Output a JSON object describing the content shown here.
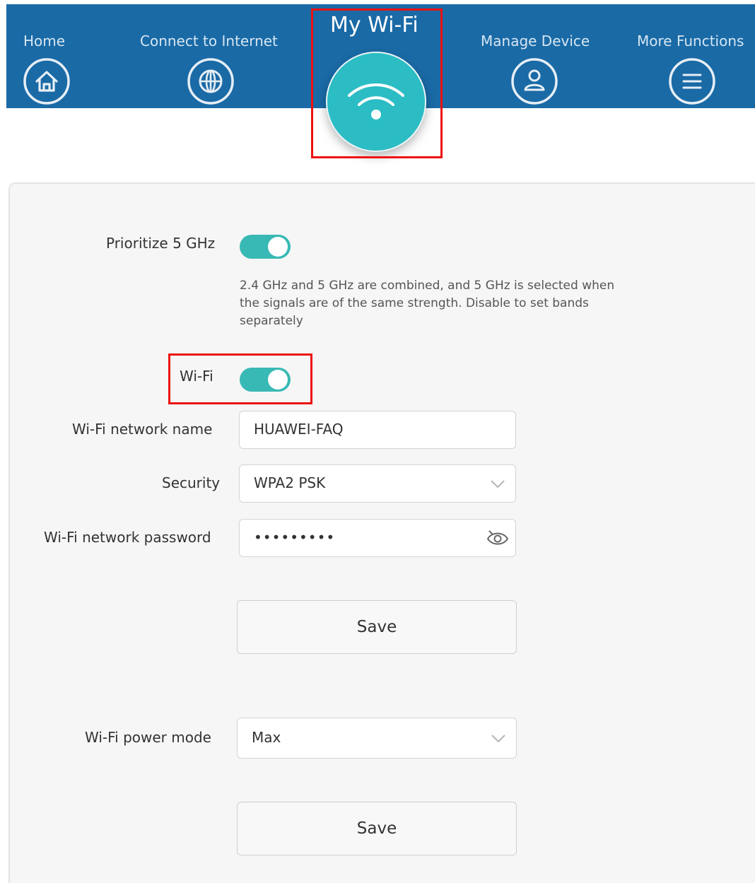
{
  "nav": {
    "home": "Home",
    "connect": "Connect to Internet",
    "mywifi": "My Wi-Fi",
    "manage": "Manage Device",
    "more": "More Functions"
  },
  "settings": {
    "prioritize_label": "Prioritize 5 GHz",
    "prioritize_desc": "2.4 GHz and 5 GHz are combined, and 5 GHz is selected when the signals are of the same strength. Disable to set bands separately",
    "wifi_label": "Wi-Fi",
    "network_name_label": "Wi-Fi network name",
    "network_name_value": "HUAWEI-FAQ",
    "security_label": "Security",
    "security_value": "WPA2 PSK",
    "password_label": "Wi-Fi network password",
    "password_value": "•••••••••",
    "save_label": "Save",
    "power_label": "Wi-Fi power mode",
    "power_value": "Max",
    "save2_label": "Save"
  },
  "state": {
    "prioritize_enabled": true,
    "wifi_enabled": true
  },
  "colors": {
    "header": "#1a6aa6",
    "accent": "#2bbcc4",
    "toggle_on": "#39b9b5",
    "highlight": "#ee1111"
  },
  "icons": [
    "home-icon",
    "globe-icon",
    "wifi-icon",
    "user-icon",
    "menu-icon",
    "chevron-down-icon",
    "eye-icon"
  ]
}
